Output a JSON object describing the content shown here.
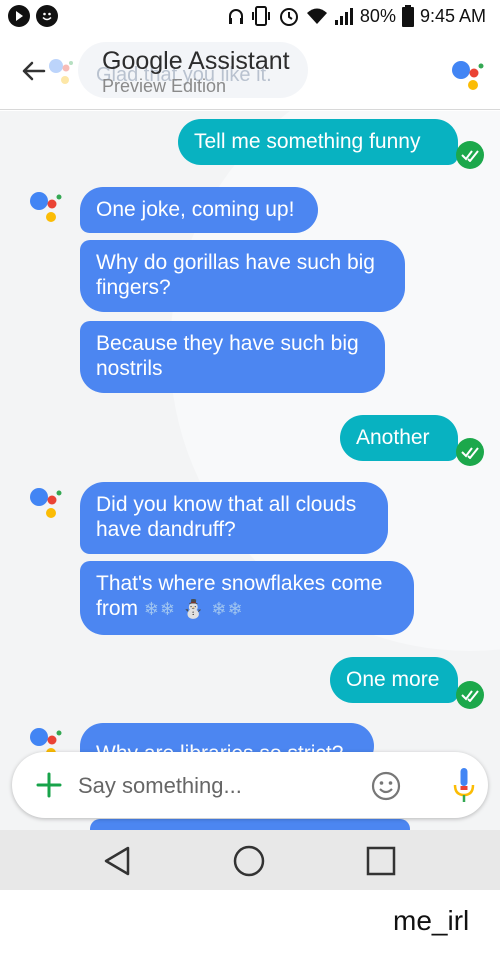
{
  "status_bar": {
    "battery": "80%",
    "time": "9:45 AM"
  },
  "header": {
    "title": "Google Assistant",
    "subtitle": "Preview Edition",
    "ghost_text": "Glad that you like it."
  },
  "messages": [
    {
      "sender": "user",
      "text": "Tell me something funny"
    },
    {
      "sender": "assistant",
      "text": "One joke, coming up!"
    },
    {
      "sender": "assistant",
      "text": "Why do gorillas have such big fingers?"
    },
    {
      "sender": "assistant",
      "text": "Because they have such big nostrils"
    },
    {
      "sender": "user",
      "text": "Another"
    },
    {
      "sender": "assistant",
      "text": "Did you know that all clouds have dandruff?"
    },
    {
      "sender": "assistant",
      "text": "That's where snowflakes come from",
      "emoji": "❄❄ ⛄ ❄❄"
    },
    {
      "sender": "user",
      "text": "One more"
    },
    {
      "sender": "assistant",
      "text": "Why are libraries so strict?"
    }
  ],
  "input": {
    "placeholder": "Say something..."
  },
  "nav": {
    "back": "back-icon",
    "home": "home-icon",
    "recents": "recents-icon"
  },
  "caption": "me_irl",
  "colors": {
    "user_bubble": "#08b2c1",
    "assistant_bubble": "#4c86f1",
    "check": "#1ca84b",
    "google_blue": "#4285f4",
    "google_red": "#ea4335",
    "google_yellow": "#fbbc05",
    "google_green": "#34a853"
  }
}
